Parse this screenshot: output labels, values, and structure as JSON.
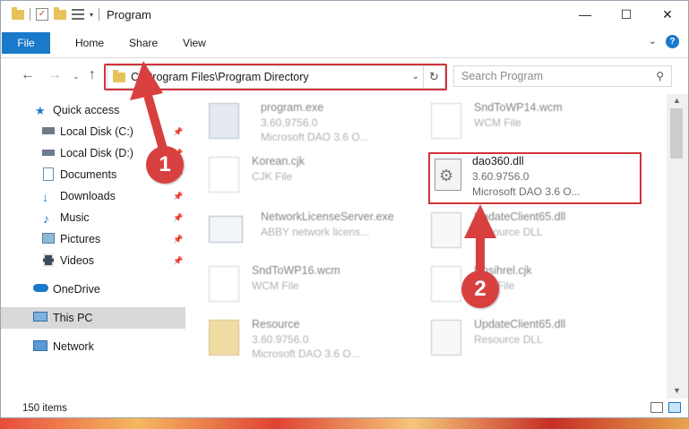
{
  "window": {
    "title": "Program"
  },
  "ribbon": {
    "tabs": [
      "File",
      "Home",
      "Share",
      "View"
    ]
  },
  "nav": {
    "address": "C:\\Program Files\\Program Directory",
    "search_placeholder": "Search Program"
  },
  "sidebar": {
    "items": [
      {
        "label": "Quick access",
        "icon": "star-icon",
        "pinned": false
      },
      {
        "label": "Local Disk (C:)",
        "icon": "drive-icon",
        "pinned": true
      },
      {
        "label": "Local Disk (D:)",
        "icon": "drive-icon",
        "pinned": true
      },
      {
        "label": "Documents",
        "icon": "document-icon",
        "pinned": true
      },
      {
        "label": "Downloads",
        "icon": "download-icon",
        "pinned": true
      },
      {
        "label": "Music",
        "icon": "music-icon",
        "pinned": true
      },
      {
        "label": "Pictures",
        "icon": "pictures-icon",
        "pinned": true
      },
      {
        "label": "Videos",
        "icon": "videos-icon",
        "pinned": true
      },
      {
        "label": "OneDrive",
        "icon": "cloud-icon",
        "pinned": false
      },
      {
        "label": "This PC",
        "icon": "monitor-icon",
        "pinned": false
      },
      {
        "label": "Network",
        "icon": "network-icon",
        "pinned": false
      }
    ]
  },
  "files": [
    {
      "name": "program.exe",
      "type": "3.60.9756.0",
      "desc": "Microsoft DAO 3.6 O...",
      "icon": "exe-icon"
    },
    {
      "name": "SndToWP14.wcm",
      "type": "WCM File",
      "desc": "",
      "icon": "blank-file-icon"
    },
    {
      "name": "Korean.cjk",
      "type": "CJK File",
      "desc": "",
      "icon": "blank-file-icon"
    },
    {
      "name": "dao360.dll",
      "type": "3.60.9756.0",
      "desc": "Microsoft DAO 3.6 O...",
      "icon": "dll-icon"
    },
    {
      "name": "NetworkLicenseServer.exe",
      "type": "ABBY network licens...",
      "desc": "",
      "icon": "app-window-icon"
    },
    {
      "name": "UpdateClient65.dll",
      "type": "Resource DLL",
      "desc": "",
      "icon": "dll-icon"
    },
    {
      "name": "SndToWP16.wcm",
      "type": "WCM File",
      "desc": "",
      "icon": "blank-file-icon"
    },
    {
      "name": "Unsihrel.cjk",
      "type": "CJK File",
      "desc": "",
      "icon": "blank-file-icon"
    },
    {
      "name": "Resource",
      "type": "3.60.9756.0",
      "desc": "Microsoft DAO 3.6 O...",
      "icon": "archive-icon"
    },
    {
      "name": "UpdateClient65.dll",
      "type": "Resource DLL",
      "desc": "",
      "icon": "dll-icon"
    }
  ],
  "status": {
    "count": "150 items"
  },
  "annotations": {
    "step1": "1",
    "step2": "2",
    "color": "#d0333a"
  }
}
